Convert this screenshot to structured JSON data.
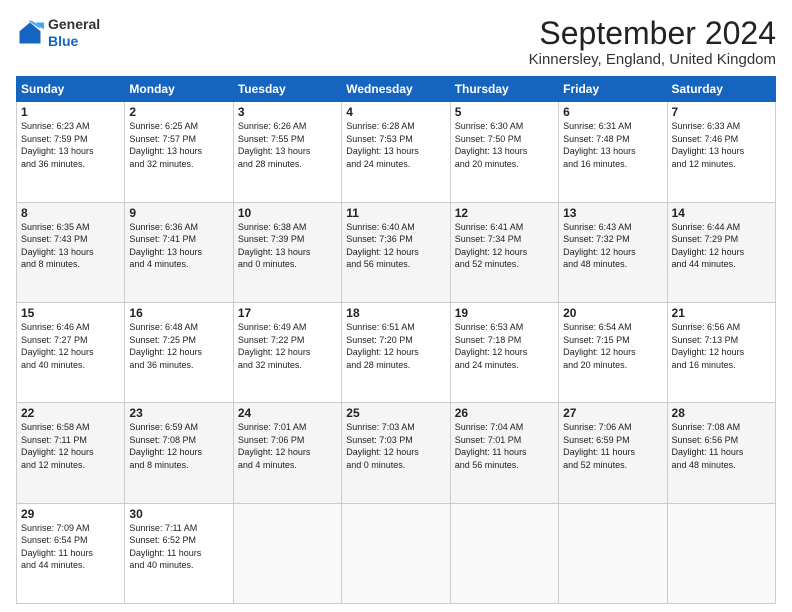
{
  "logo": {
    "line1": "General",
    "line2": "Blue"
  },
  "title": "September 2024",
  "subtitle": "Kinnersley, England, United Kingdom",
  "days_of_week": [
    "Sunday",
    "Monday",
    "Tuesday",
    "Wednesday",
    "Thursday",
    "Friday",
    "Saturday"
  ],
  "weeks": [
    [
      {
        "day": "1",
        "info": "Sunrise: 6:23 AM\nSunset: 7:59 PM\nDaylight: 13 hours\nand 36 minutes."
      },
      {
        "day": "2",
        "info": "Sunrise: 6:25 AM\nSunset: 7:57 PM\nDaylight: 13 hours\nand 32 minutes."
      },
      {
        "day": "3",
        "info": "Sunrise: 6:26 AM\nSunset: 7:55 PM\nDaylight: 13 hours\nand 28 minutes."
      },
      {
        "day": "4",
        "info": "Sunrise: 6:28 AM\nSunset: 7:53 PM\nDaylight: 13 hours\nand 24 minutes."
      },
      {
        "day": "5",
        "info": "Sunrise: 6:30 AM\nSunset: 7:50 PM\nDaylight: 13 hours\nand 20 minutes."
      },
      {
        "day": "6",
        "info": "Sunrise: 6:31 AM\nSunset: 7:48 PM\nDaylight: 13 hours\nand 16 minutes."
      },
      {
        "day": "7",
        "info": "Sunrise: 6:33 AM\nSunset: 7:46 PM\nDaylight: 13 hours\nand 12 minutes."
      }
    ],
    [
      {
        "day": "8",
        "info": "Sunrise: 6:35 AM\nSunset: 7:43 PM\nDaylight: 13 hours\nand 8 minutes."
      },
      {
        "day": "9",
        "info": "Sunrise: 6:36 AM\nSunset: 7:41 PM\nDaylight: 13 hours\nand 4 minutes."
      },
      {
        "day": "10",
        "info": "Sunrise: 6:38 AM\nSunset: 7:39 PM\nDaylight: 13 hours\nand 0 minutes."
      },
      {
        "day": "11",
        "info": "Sunrise: 6:40 AM\nSunset: 7:36 PM\nDaylight: 12 hours\nand 56 minutes."
      },
      {
        "day": "12",
        "info": "Sunrise: 6:41 AM\nSunset: 7:34 PM\nDaylight: 12 hours\nand 52 minutes."
      },
      {
        "day": "13",
        "info": "Sunrise: 6:43 AM\nSunset: 7:32 PM\nDaylight: 12 hours\nand 48 minutes."
      },
      {
        "day": "14",
        "info": "Sunrise: 6:44 AM\nSunset: 7:29 PM\nDaylight: 12 hours\nand 44 minutes."
      }
    ],
    [
      {
        "day": "15",
        "info": "Sunrise: 6:46 AM\nSunset: 7:27 PM\nDaylight: 12 hours\nand 40 minutes."
      },
      {
        "day": "16",
        "info": "Sunrise: 6:48 AM\nSunset: 7:25 PM\nDaylight: 12 hours\nand 36 minutes."
      },
      {
        "day": "17",
        "info": "Sunrise: 6:49 AM\nSunset: 7:22 PM\nDaylight: 12 hours\nand 32 minutes."
      },
      {
        "day": "18",
        "info": "Sunrise: 6:51 AM\nSunset: 7:20 PM\nDaylight: 12 hours\nand 28 minutes."
      },
      {
        "day": "19",
        "info": "Sunrise: 6:53 AM\nSunset: 7:18 PM\nDaylight: 12 hours\nand 24 minutes."
      },
      {
        "day": "20",
        "info": "Sunrise: 6:54 AM\nSunset: 7:15 PM\nDaylight: 12 hours\nand 20 minutes."
      },
      {
        "day": "21",
        "info": "Sunrise: 6:56 AM\nSunset: 7:13 PM\nDaylight: 12 hours\nand 16 minutes."
      }
    ],
    [
      {
        "day": "22",
        "info": "Sunrise: 6:58 AM\nSunset: 7:11 PM\nDaylight: 12 hours\nand 12 minutes."
      },
      {
        "day": "23",
        "info": "Sunrise: 6:59 AM\nSunset: 7:08 PM\nDaylight: 12 hours\nand 8 minutes."
      },
      {
        "day": "24",
        "info": "Sunrise: 7:01 AM\nSunset: 7:06 PM\nDaylight: 12 hours\nand 4 minutes."
      },
      {
        "day": "25",
        "info": "Sunrise: 7:03 AM\nSunset: 7:03 PM\nDaylight: 12 hours\nand 0 minutes."
      },
      {
        "day": "26",
        "info": "Sunrise: 7:04 AM\nSunset: 7:01 PM\nDaylight: 11 hours\nand 56 minutes."
      },
      {
        "day": "27",
        "info": "Sunrise: 7:06 AM\nSunset: 6:59 PM\nDaylight: 11 hours\nand 52 minutes."
      },
      {
        "day": "28",
        "info": "Sunrise: 7:08 AM\nSunset: 6:56 PM\nDaylight: 11 hours\nand 48 minutes."
      }
    ],
    [
      {
        "day": "29",
        "info": "Sunrise: 7:09 AM\nSunset: 6:54 PM\nDaylight: 11 hours\nand 44 minutes."
      },
      {
        "day": "30",
        "info": "Sunrise: 7:11 AM\nSunset: 6:52 PM\nDaylight: 11 hours\nand 40 minutes."
      },
      {
        "day": "",
        "info": ""
      },
      {
        "day": "",
        "info": ""
      },
      {
        "day": "",
        "info": ""
      },
      {
        "day": "",
        "info": ""
      },
      {
        "day": "",
        "info": ""
      }
    ]
  ]
}
